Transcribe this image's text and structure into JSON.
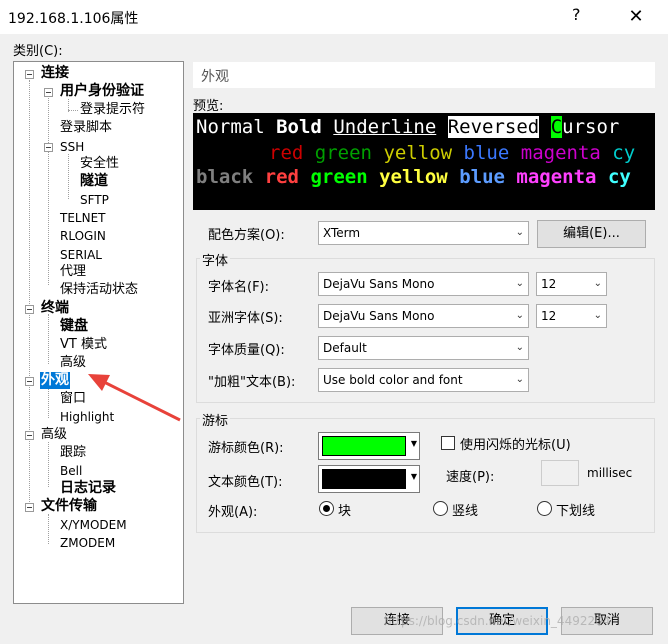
{
  "window": {
    "title": "192.168.1.106属性",
    "help": "?",
    "close": "✕"
  },
  "category_label": "类别(C):",
  "tree": {
    "items": [
      "连接",
      "用户身份验证",
      "登录提示符",
      "登录脚本",
      "SSH",
      "安全性",
      "隧道",
      "SFTP",
      "TELNET",
      "RLOGIN",
      "SERIAL",
      "代理",
      "保持活动状态",
      "终端",
      "键盘",
      "VT 模式",
      "高级",
      "外观",
      "窗口",
      "Highlight",
      "高级",
      "跟踪",
      "Bell",
      "日志记录",
      "文件传输",
      "X/YMODEM",
      "ZMODEM"
    ],
    "selected": "外观"
  },
  "header": "外观",
  "preview": {
    "label": "预览:",
    "line1": {
      "normal": "Normal",
      "bold": "Bold",
      "underline": "Underline",
      "reversed": "Reversed",
      "cursor_char": "C",
      "cursor_rest": "ursor"
    },
    "line2": [
      "red",
      "green",
      "yellow",
      "blue",
      "magenta",
      "cy"
    ],
    "line3": [
      "black",
      "red",
      "green",
      "yellow",
      "blue",
      "magenta",
      "cy"
    ],
    "colors": {
      "dim": {
        "red": "#cd0000",
        "green": "#00a000",
        "yellow": "#cdcd00",
        "blue": "#3b78ff",
        "magenta": "#cd00cd",
        "cyan": "#00cdcd"
      },
      "bright": {
        "black": "#7f7f7f",
        "red": "#ff4040",
        "green": "#00ff00",
        "yellow": "#ffff40",
        "blue": "#5c9cff",
        "magenta": "#ff40ff",
        "cyan": "#40ffff"
      },
      "cursor": "#00ff00"
    }
  },
  "color_scheme": {
    "label": "配色方案(O):",
    "value": "XTerm",
    "edit_button": "编辑(E)..."
  },
  "font_group": {
    "title": "字体",
    "font_name_label": "字体名(F):",
    "font_name_value": "DejaVu Sans Mono",
    "font_size": "12",
    "asian_font_label": "亚洲字体(S):",
    "asian_font_value": "DejaVu Sans Mono",
    "asian_size": "12",
    "quality_label": "字体质量(Q):",
    "quality_value": "Default",
    "bold_label": "\"加粗\"文本(B):",
    "bold_value": "Use bold color and font"
  },
  "cursor_group": {
    "title": "游标",
    "cursor_color_label": "游标颜色(R):",
    "cursor_color": "#00ff00",
    "text_color_label": "文本颜色(T):",
    "text_color": "#000000",
    "blink_label": "使用闪烁的光标(U)",
    "blink_checked": false,
    "speed_label": "速度(P):",
    "speed_unit": "millisec",
    "appearance_label": "外观(A):",
    "shapes": [
      "块",
      "竖线",
      "下划线"
    ],
    "selected_shape": "块"
  },
  "buttons": {
    "connect": "连接",
    "ok": "确定",
    "cancel": "取消"
  },
  "watermark": "https://blog.csdn.net/weixin_4492204",
  "annotation_arrow_color": "#e8423a"
}
